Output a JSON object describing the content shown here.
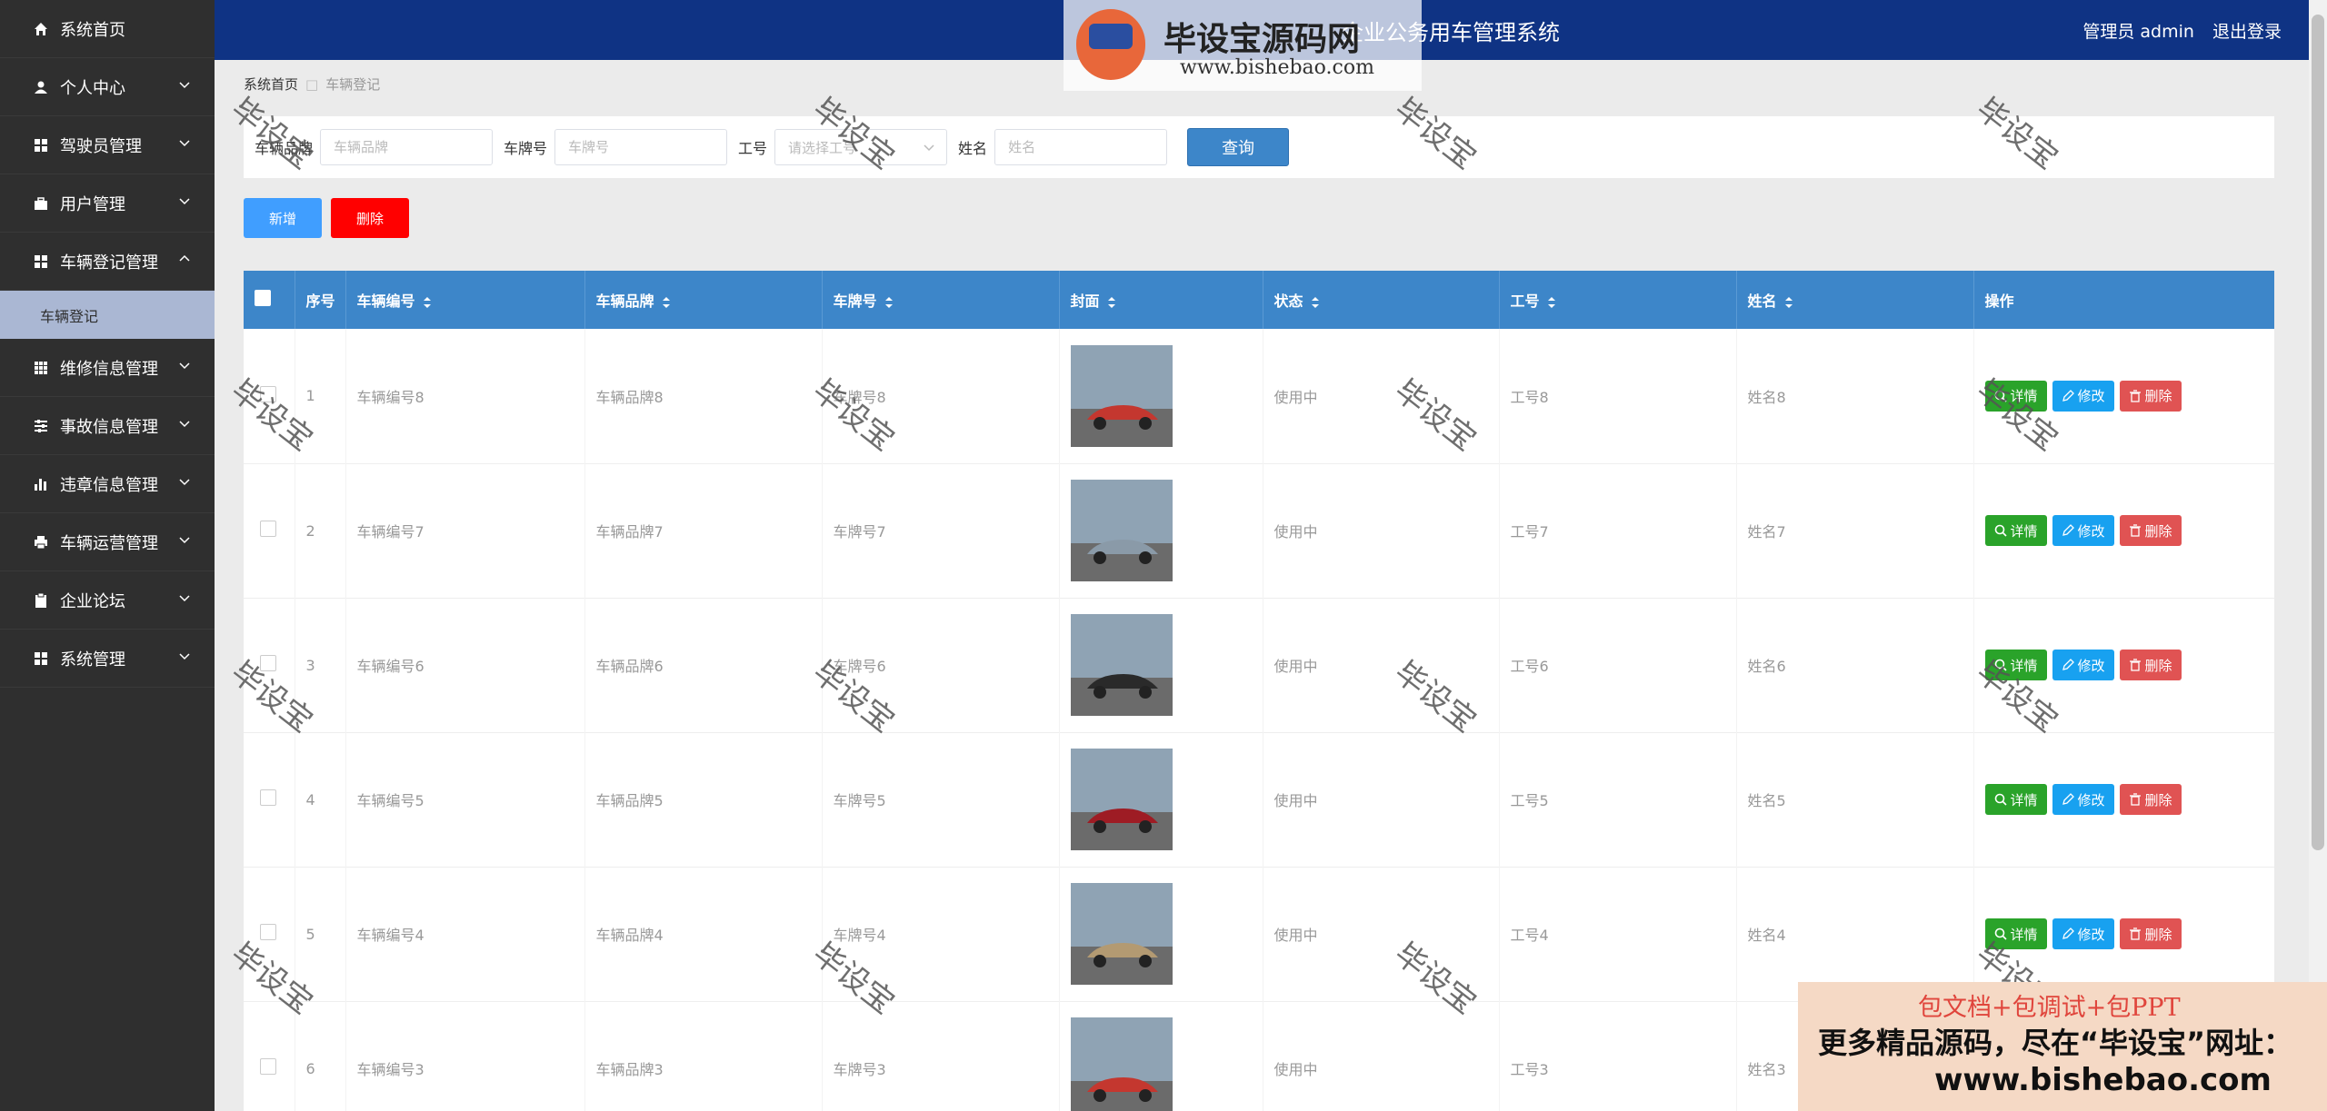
{
  "app": {
    "header_title": "企业公务用车管理系统",
    "user_label": "管理员 admin",
    "logout_label": "退出登录"
  },
  "sidebar": {
    "items": [
      {
        "label": "系统首页",
        "icon": "home-icon"
      },
      {
        "label": "个人中心",
        "icon": "user-icon"
      },
      {
        "label": "驾驶员管理",
        "icon": "grid-icon"
      },
      {
        "label": "用户管理",
        "icon": "briefcase-icon"
      },
      {
        "label": "车辆登记管理",
        "icon": "grid-icon",
        "expanded": true
      },
      {
        "label": "维修信息管理",
        "icon": "table-icon"
      },
      {
        "label": "事故信息管理",
        "icon": "sliders-icon"
      },
      {
        "label": "违章信息管理",
        "icon": "bar-chart-icon"
      },
      {
        "label": "车辆运营管理",
        "icon": "printer-icon"
      },
      {
        "label": "企业论坛",
        "icon": "clipboard-icon"
      },
      {
        "label": "系统管理",
        "icon": "grid-icon"
      }
    ],
    "submenu_item": "车辆登记"
  },
  "breadcrumb": {
    "home": "系统首页",
    "current": "车辆登记"
  },
  "search": {
    "brand_label": "车辆品牌",
    "brand_placeholder": "车辆品牌",
    "plate_label": "车牌号",
    "plate_placeholder": "车牌号",
    "worknum_label": "工号",
    "worknum_placeholder": "请选择工号",
    "name_label": "姓名",
    "name_placeholder": "姓名",
    "query_button": "查询"
  },
  "actions": {
    "add_button": "新增",
    "delete_button": "删除"
  },
  "table": {
    "headers": [
      "序号",
      "车辆编号",
      "车辆品牌",
      "车牌号",
      "封面",
      "状态",
      "工号",
      "姓名",
      "操作"
    ],
    "op_labels": {
      "detail": "详情",
      "edit": "修改",
      "delete": "删除"
    },
    "rows": [
      {
        "index": "1",
        "code": "车辆编号8",
        "brand": "车辆品牌8",
        "plate": "车牌号8",
        "status": "使用中",
        "worknum": "工号8",
        "name": "姓名8",
        "cover_color": "#c4372f"
      },
      {
        "index": "2",
        "code": "车辆编号7",
        "brand": "车辆品牌7",
        "plate": "车牌号7",
        "status": "使用中",
        "worknum": "工号7",
        "name": "姓名7",
        "cover_color": "#8a9aa8"
      },
      {
        "index": "3",
        "code": "车辆编号6",
        "brand": "车辆品牌6",
        "plate": "车牌号6",
        "status": "使用中",
        "worknum": "工号6",
        "name": "姓名6",
        "cover_color": "#2a2a2a"
      },
      {
        "index": "4",
        "code": "车辆编号5",
        "brand": "车辆品牌5",
        "plate": "车牌号5",
        "status": "使用中",
        "worknum": "工号5",
        "name": "姓名5",
        "cover_color": "#9e1c24"
      },
      {
        "index": "5",
        "code": "车辆编号4",
        "brand": "车辆品牌4",
        "plate": "车牌号4",
        "status": "使用中",
        "worknum": "工号4",
        "name": "姓名4",
        "cover_color": "#b39a72"
      },
      {
        "index": "6",
        "code": "车辆编号3",
        "brand": "车辆品牌3",
        "plate": "车牌号3",
        "status": "使用中",
        "worknum": "工号3",
        "name": "姓名3",
        "cover_color": "#c4372f"
      }
    ]
  },
  "watermark": {
    "text": "毕设宝",
    "logo_text": "毕设宝源码网",
    "logo_url": "www.bishebao.com",
    "promo_line1": "包文档+包调试+包PPT",
    "promo_line2": "更多精品源码，尽在“毕设宝”网址：",
    "promo_line3": "www.bishebao.com"
  }
}
